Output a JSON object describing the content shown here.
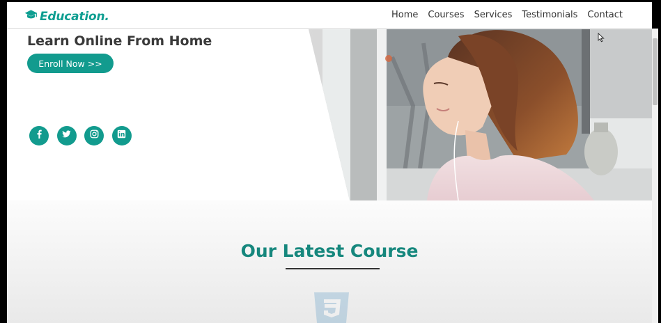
{
  "brand": {
    "name": "Education.",
    "icon": "graduation-cap-icon",
    "color": "#0e9e91"
  },
  "nav": {
    "items": [
      {
        "label": "Home"
      },
      {
        "label": "Courses"
      },
      {
        "label": "Services"
      },
      {
        "label": "Testimonials"
      },
      {
        "label": "Contact"
      }
    ]
  },
  "hero": {
    "title": "Learn Online From Home",
    "cta_label": "Enroll Now >>",
    "accent": "#129b8e",
    "socials": [
      {
        "icon": "facebook-icon"
      },
      {
        "icon": "twitter-icon"
      },
      {
        "icon": "instagram-icon"
      },
      {
        "icon": "linkedin-icon"
      }
    ],
    "image": "woman-studying-photo"
  },
  "section": {
    "title": "Our Latest Course",
    "title_color": "#16877d",
    "icon": "css3-icon"
  }
}
